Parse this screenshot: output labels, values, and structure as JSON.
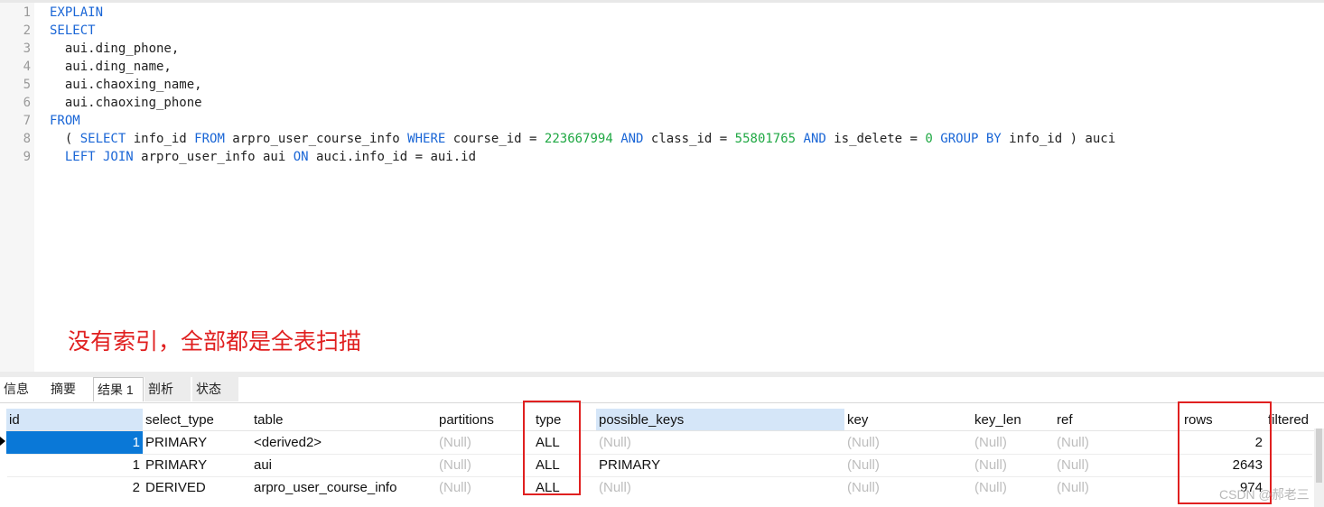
{
  "editor": {
    "line_numbers": [
      "1",
      "2",
      "3",
      "4",
      "5",
      "6",
      "7",
      "8",
      "9"
    ],
    "lines": {
      "l1": "EXPLAIN",
      "l2": "SELECT",
      "l3": "  aui.ding_phone,",
      "l4": "  aui.ding_name,",
      "l5": "  aui.chaoxing_name,",
      "l6": "  aui.chaoxing_phone",
      "l7": "FROM",
      "l8": {
        "open": "  ( ",
        "select": "SELECT",
        "t1": " info_id ",
        "from": "FROM",
        "t2": " arpro_user_course_info ",
        "where": "WHERE",
        "t3": " course_id = ",
        "n1": "223667994",
        "sp1": " ",
        "and1": "AND",
        "t4": " class_id = ",
        "n2": "55801765",
        "sp2": " ",
        "and2": "AND",
        "t5": " is_delete = ",
        "n3": "0",
        "sp3": " ",
        "group": "GROUP BY",
        "t6": " info_id ) auci"
      },
      "l9": {
        "indent": "  ",
        "join": "LEFT JOIN",
        "t1": " arpro_user_info aui ",
        "on": "ON",
        "t2": " auci.info_id = aui.id"
      }
    },
    "annotation": "没有索引，全部都是全表扫描"
  },
  "tabs": [
    "信息",
    "摘要",
    "结果 1",
    "剖析",
    "状态"
  ],
  "active_tab": "结果 1",
  "grid": {
    "columns": [
      "id",
      "select_type",
      "table",
      "partitions",
      "type",
      "possible_keys",
      "key",
      "key_len",
      "ref",
      "rows",
      "filtered"
    ],
    "rows": [
      [
        "1",
        "PRIMARY",
        "<derived2>",
        "(Null)",
        "ALL",
        "(Null)",
        "(Null)",
        "(Null)",
        "(Null)",
        "2"
      ],
      [
        "1",
        "PRIMARY",
        "aui",
        "(Null)",
        "ALL",
        "PRIMARY",
        "(Null)",
        "(Null)",
        "(Null)",
        "2643"
      ],
      [
        "2",
        "DERIVED",
        "arpro_user_course_info",
        "(Null)",
        "ALL",
        "(Null)",
        "(Null)",
        "(Null)",
        "(Null)",
        "974"
      ]
    ],
    "selected_row": 0
  },
  "watermark": "CSDN @郝老三",
  "colors": {
    "keyword": "#1a66d6",
    "number": "#1fa843",
    "annotation": "#e02020",
    "selection": "#0a78d7"
  }
}
